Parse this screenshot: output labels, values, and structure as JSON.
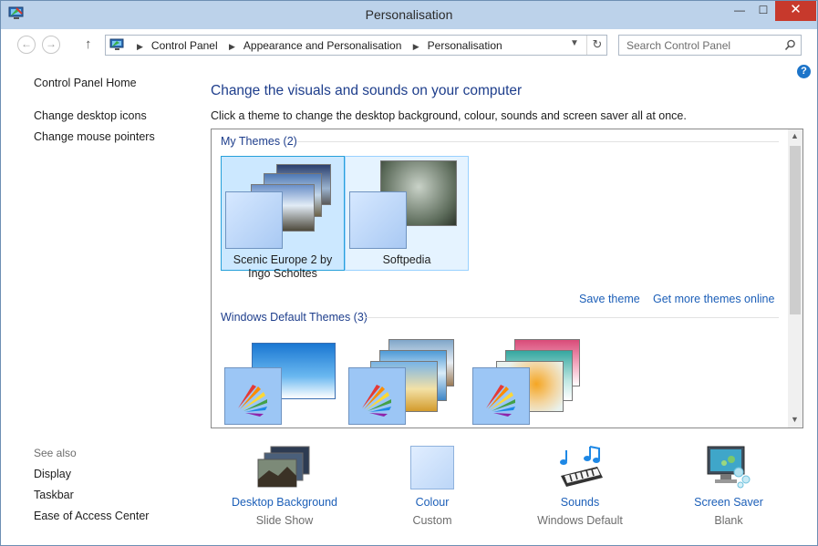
{
  "window": {
    "title": "Personalisation",
    "controls": {
      "minimize": "—",
      "maximize": "☐",
      "close": "✕"
    }
  },
  "address": {
    "breadcrumbs": [
      "Control Panel",
      "Appearance and Personalisation",
      "Personalisation"
    ],
    "search_placeholder": "Search Control Panel"
  },
  "left_pane": {
    "home": "Control Panel Home",
    "links": [
      "Change desktop icons",
      "Change mouse pointers"
    ],
    "see_also_title": "See also",
    "see_also": [
      "Display",
      "Taskbar",
      "Ease of Access Center"
    ]
  },
  "main": {
    "heading": "Change the visuals and sounds on your computer",
    "subtext": "Click a theme to change the desktop background, colour, sounds and screen saver all at once.",
    "my_themes_title": "My Themes (2)",
    "my_themes": [
      {
        "name": "Scenic Europe 2 by Ingo Scholtes",
        "selected": true
      },
      {
        "name": "Softpedia",
        "selected": false
      }
    ],
    "save_theme": "Save theme",
    "get_more_themes": "Get more themes online",
    "default_themes_title": "Windows Default Themes (3)"
  },
  "bottom": {
    "desktop_background": {
      "label": "Desktop Background",
      "value": "Slide Show"
    },
    "colour": {
      "label": "Colour",
      "value": "Custom"
    },
    "sounds": {
      "label": "Sounds",
      "value": "Windows Default"
    },
    "screen_saver": {
      "label": "Screen Saver",
      "value": "Blank"
    }
  },
  "colors": {
    "title_bar": "#bcd2ea",
    "link_blue": "#1c5fb8",
    "heading_blue": "#1e3e8c",
    "close_red": "#c7392c",
    "selection": "#cce8ff"
  }
}
